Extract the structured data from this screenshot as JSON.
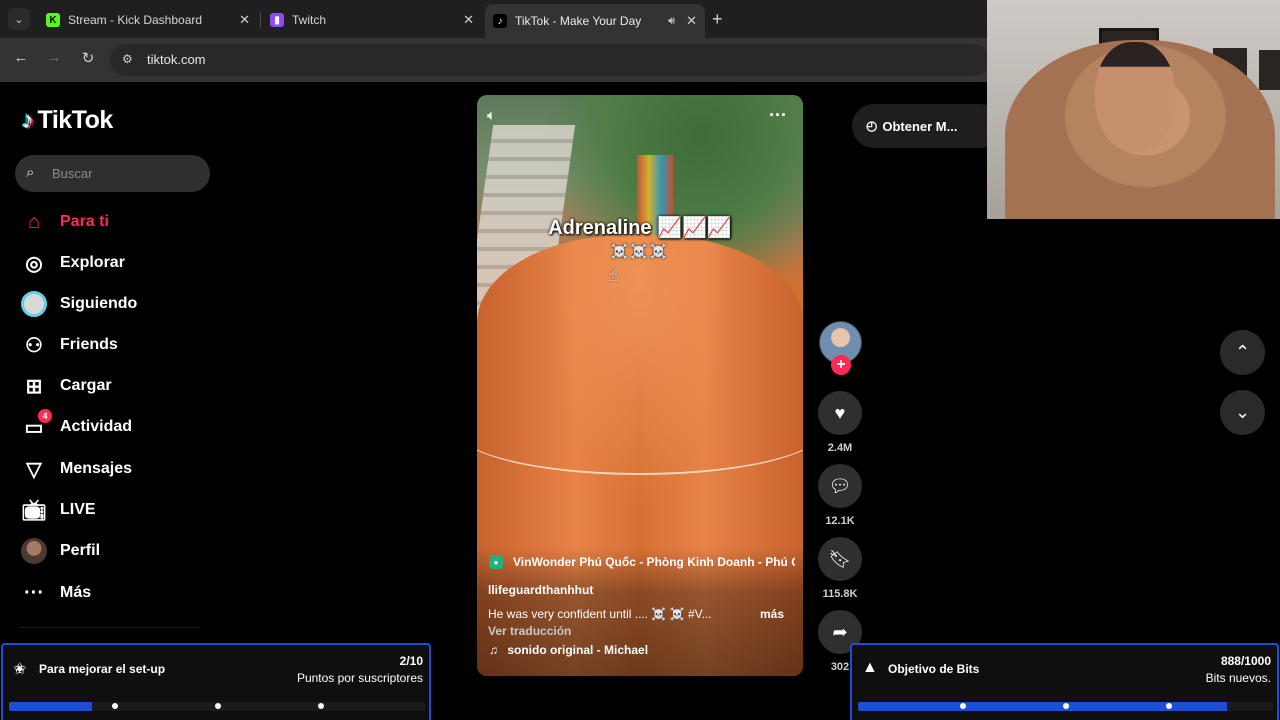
{
  "browser": {
    "tabs": [
      {
        "title": "Stream - Kick Dashboard",
        "favicon": "K"
      },
      {
        "title": "Twitch",
        "favicon": "twitch-logo"
      },
      {
        "title": "TikTok - Make Your Day",
        "favicon": "tiktok-logo"
      }
    ],
    "url": "tiktok.com"
  },
  "tiktok": {
    "brand": "TikTok",
    "search_placeholder": "Buscar",
    "nav": [
      {
        "label": "Para ti",
        "icon": "home-icon",
        "active": true
      },
      {
        "label": "Explorar",
        "icon": "compass-icon"
      },
      {
        "label": "Siguiendo",
        "icon": "following-icon"
      },
      {
        "label": "Friends",
        "icon": "friends-icon"
      },
      {
        "label": "Cargar",
        "icon": "upload-icon"
      },
      {
        "label": "Actividad",
        "icon": "activity-icon",
        "badge": "4"
      },
      {
        "label": "Mensajes",
        "icon": "messages-icon"
      },
      {
        "label": "LIVE",
        "icon": "live-icon"
      },
      {
        "label": "Perfil",
        "icon": "profile-avatar"
      },
      {
        "label": "Más",
        "icon": "more-icon"
      }
    ],
    "get_app": "Obtener M...",
    "video": {
      "overlay_title": "Adrenaline 📈📈📈",
      "skulls": "☠️☠️☠️",
      "location": "VinWonder Phú Quốc - Phòng Kinh Doanh - Phú Q",
      "author": "llifeguardthanhhut",
      "caption": "He was very confident until .... ☠️ ☠️   #V...",
      "more": "más",
      "translate": "Ver traducción",
      "sound": "sonido original - Michael"
    },
    "actions": {
      "likes": "2.4M",
      "comments": "12.1K",
      "saves": "115.8K",
      "shares": "302"
    }
  },
  "goals": {
    "setup": {
      "title": "Para mejorar el set-up",
      "current": "2",
      "total": "/10",
      "subtitle": "Puntos por suscriptores",
      "progress": 0.2
    },
    "bits": {
      "title": "Objetivo de Bits",
      "current": "888",
      "total": "/1000",
      "subtitle": "Bits nuevos.",
      "progress": 0.888
    }
  },
  "colors": {
    "accent": "#fe2c55",
    "goal_blue": "#1d4ed8"
  }
}
